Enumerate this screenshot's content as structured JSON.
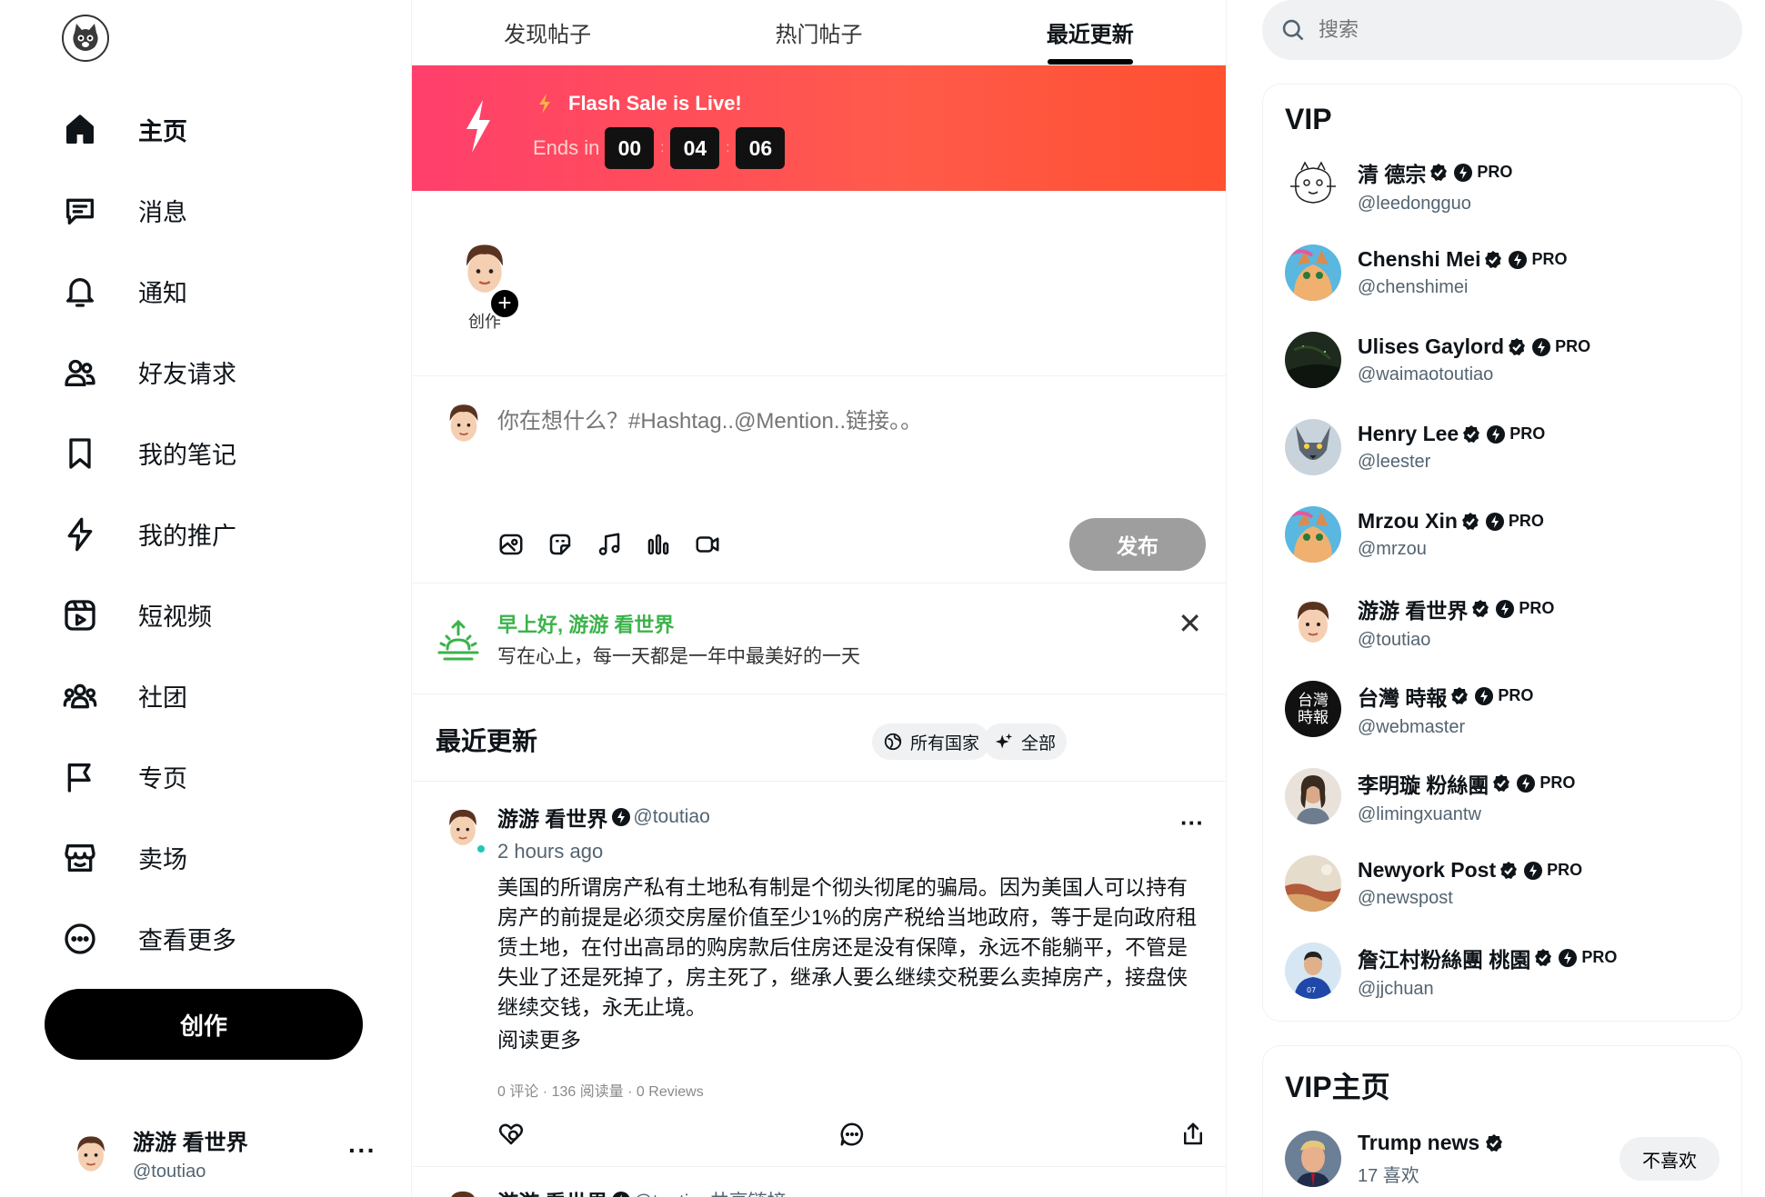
{
  "nav": {
    "items": [
      {
        "label": "主页",
        "icon": "home-icon",
        "active": true
      },
      {
        "label": "消息",
        "icon": "message-icon"
      },
      {
        "label": "通知",
        "icon": "bell-icon"
      },
      {
        "label": "好友请求",
        "icon": "friends-icon"
      },
      {
        "label": "我的笔记",
        "icon": "bookmark-icon"
      },
      {
        "label": "我的推广",
        "icon": "bolt-icon"
      },
      {
        "label": "短视频",
        "icon": "video-icon"
      },
      {
        "label": "社团",
        "icon": "group-icon"
      },
      {
        "label": "专页",
        "icon": "flag-icon"
      },
      {
        "label": "卖场",
        "icon": "store-icon"
      },
      {
        "label": "查看更多",
        "icon": "more-icon"
      }
    ],
    "create_label": "创作"
  },
  "me": {
    "name": "游游 看世界",
    "handle": "@toutiao",
    "more": "···"
  },
  "tabs": [
    "发现帖子",
    "热门帖子",
    "最近更新"
  ],
  "flash": {
    "title": "Flash Sale is Live!",
    "ends_label": "Ends in",
    "hours": "00",
    "minutes": "04",
    "seconds": "06",
    "sep": ":"
  },
  "story": {
    "label": "创作"
  },
  "composer": {
    "placeholder": "你在想什么？#Hashtag..@Mention..链接。。",
    "post_label": "发布",
    "tools": [
      "photo-icon",
      "sticker-icon",
      "music-icon",
      "poll-icon",
      "camera-icon"
    ]
  },
  "greeting": {
    "title": "早上好, 游游 看世界",
    "subtitle": "写在心上，每一天都是一年中最美好的一天",
    "close": "✕"
  },
  "recent": {
    "title": "最近更新",
    "filter_country": "所有国家",
    "filter_all": "全部"
  },
  "posts": [
    {
      "name": "游游 看世界",
      "handle": "@toutiao",
      "time": "2 hours ago",
      "text": "美国的所谓房产私有土地私有制是个彻头彻尾的骗局。因为美国人可以持有房产的前提是必须交房屋价值至少1%的房产税给当地政府，等于是向政府租赁土地，在付出高昂的购房款后住房还是没有保障，永远不能躺平，不管是失业了还是死掉了，房主死了，继承人要么继续交税要么卖掉房产，接盘侠继续交钱，永无止境。",
      "read_more": "阅读更多",
      "stats": "0 评论 · 136 阅读量 · 0 Reviews",
      "more": "···"
    },
    {
      "name": "游游 看世界",
      "handle": "@toutiao共享链接",
      "more": "···"
    }
  ],
  "search": {
    "placeholder": "搜索"
  },
  "vip": {
    "title": "VIP",
    "pro_label": "PRO",
    "users": [
      {
        "name": "清 德宗",
        "handle": "@leedongguo"
      },
      {
        "name": "Chenshi Mei",
        "handle": "@chenshimei"
      },
      {
        "name": "Ulises Gaylord",
        "handle": "@waimaotoutiao"
      },
      {
        "name": "Henry Lee",
        "handle": "@leester"
      },
      {
        "name": "Mrzou Xin",
        "handle": "@mrzou"
      },
      {
        "name": "游游 看世界",
        "handle": "@toutiao"
      },
      {
        "name": "台灣 時報",
        "handle": "@webmaster",
        "avatar_text": "台灣時報"
      },
      {
        "name": "李明璇 粉絲團",
        "handle": "@limingxuantw"
      },
      {
        "name": "Newyork Post",
        "handle": "@newspost"
      },
      {
        "name": "詹江村粉絲團 桃園",
        "handle": "@jjchuan"
      }
    ]
  },
  "vip_pages": {
    "title": "VIP主页",
    "items": [
      {
        "name": "Trump news",
        "likes": "17 喜欢",
        "action": "不喜欢"
      }
    ]
  },
  "colors": {
    "accent_green": "#3bb34a",
    "flash_start": "#ff3f6c",
    "flash_end": "#ff5030",
    "online": "#22c7b3"
  }
}
